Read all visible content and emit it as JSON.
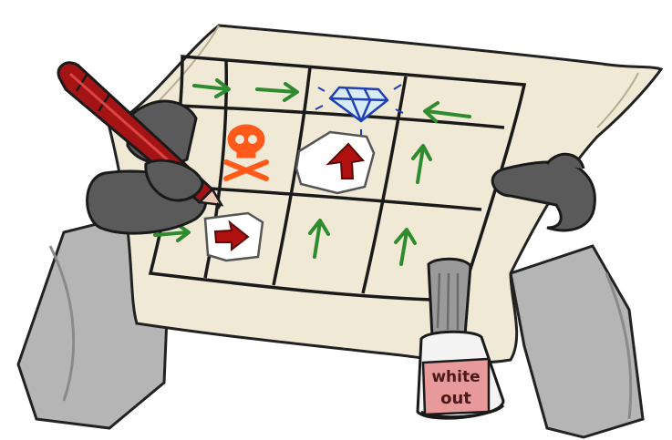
{
  "bottle": {
    "line1": "white",
    "line2": "out"
  },
  "icons": {
    "grid": [
      [
        "arrow-right-icon",
        "arrow-right-icon",
        "diamond-icon",
        "arrow-left-icon"
      ],
      [
        "skull-crossbones-icon",
        "whited-out-arrow-up-icon",
        "arrow-up-icon",
        ""
      ],
      [
        "whited-out-arrow-right-icon",
        "arrow-up-icon",
        "arrow-up-icon",
        ""
      ]
    ]
  },
  "colors": {
    "arrow": "#2e8b2e",
    "skull": "#ff5a1a",
    "diamond": "#1f3fb5",
    "corrected_arrow": "#b01010",
    "pen": "#a51414",
    "paper": "#efe9d6"
  }
}
